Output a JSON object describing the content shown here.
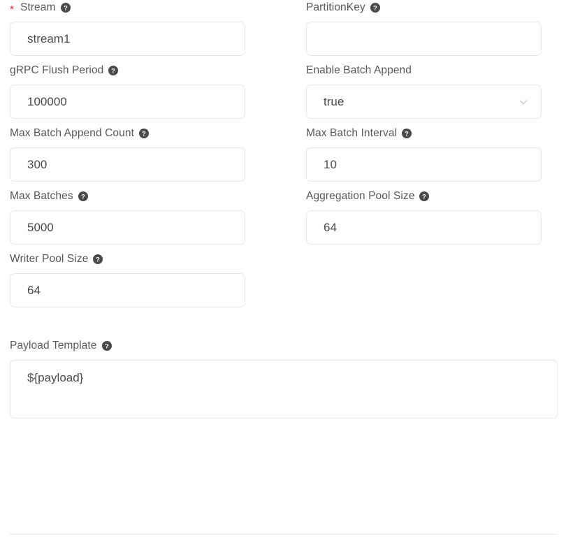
{
  "form": {
    "fields": [
      {
        "key": "stream",
        "label": "Stream",
        "required": true,
        "help": true,
        "help_icon": "question-circle-icon",
        "control": "text-input",
        "value": "stream1",
        "placeholder": ""
      },
      {
        "key": "partition_key",
        "label": "PartitionKey",
        "required": false,
        "help": true,
        "help_icon": "question-circle-icon",
        "control": "text-input",
        "value": "",
        "placeholder": ""
      },
      {
        "key": "grpc_flush_period",
        "label": "gRPC Flush Period",
        "required": false,
        "help": true,
        "help_icon": "question-circle-icon",
        "control": "text-input",
        "value": "100000",
        "placeholder": ""
      },
      {
        "key": "enable_batch_append",
        "label": "Enable Batch Append",
        "required": false,
        "help": false,
        "control": "select",
        "value": "true",
        "dropdown_icon": "chevron-down-icon",
        "options": [
          "true",
          "false"
        ]
      },
      {
        "key": "max_batch_append_count",
        "label": "Max Batch Append Count",
        "required": false,
        "help": true,
        "help_icon": "question-circle-icon",
        "control": "text-input",
        "value": "300",
        "placeholder": ""
      },
      {
        "key": "max_batch_interval",
        "label": "Max Batch Interval",
        "required": false,
        "help": true,
        "help_icon": "question-circle-icon",
        "control": "text-input",
        "value": "10",
        "placeholder": ""
      },
      {
        "key": "max_batches",
        "label": "Max Batches",
        "required": false,
        "help": true,
        "help_icon": "question-circle-icon",
        "control": "text-input",
        "value": "5000",
        "placeholder": ""
      },
      {
        "key": "aggregation_pool_size",
        "label": "Aggregation Pool Size",
        "required": false,
        "help": true,
        "help_icon": "question-circle-icon",
        "control": "text-input",
        "value": "64",
        "placeholder": ""
      },
      {
        "key": "writer_pool_size",
        "label": "Writer Pool Size",
        "required": false,
        "help": true,
        "help_icon": "question-circle-icon",
        "control": "text-input",
        "value": "64",
        "placeholder": ""
      }
    ],
    "payload": {
      "label": "Payload Template",
      "help": true,
      "help_icon": "question-circle-icon",
      "control": "textarea",
      "value": "${payload}",
      "placeholder": ""
    }
  },
  "colors": {
    "required_asterisk": "#f5222d",
    "label_text": "#595959",
    "value_text": "#4a4a4a",
    "border": "#e6e8ec",
    "help_icon_bg": "#4a4a4a",
    "chevron": "#c8ccd4",
    "background": "#ffffff"
  }
}
